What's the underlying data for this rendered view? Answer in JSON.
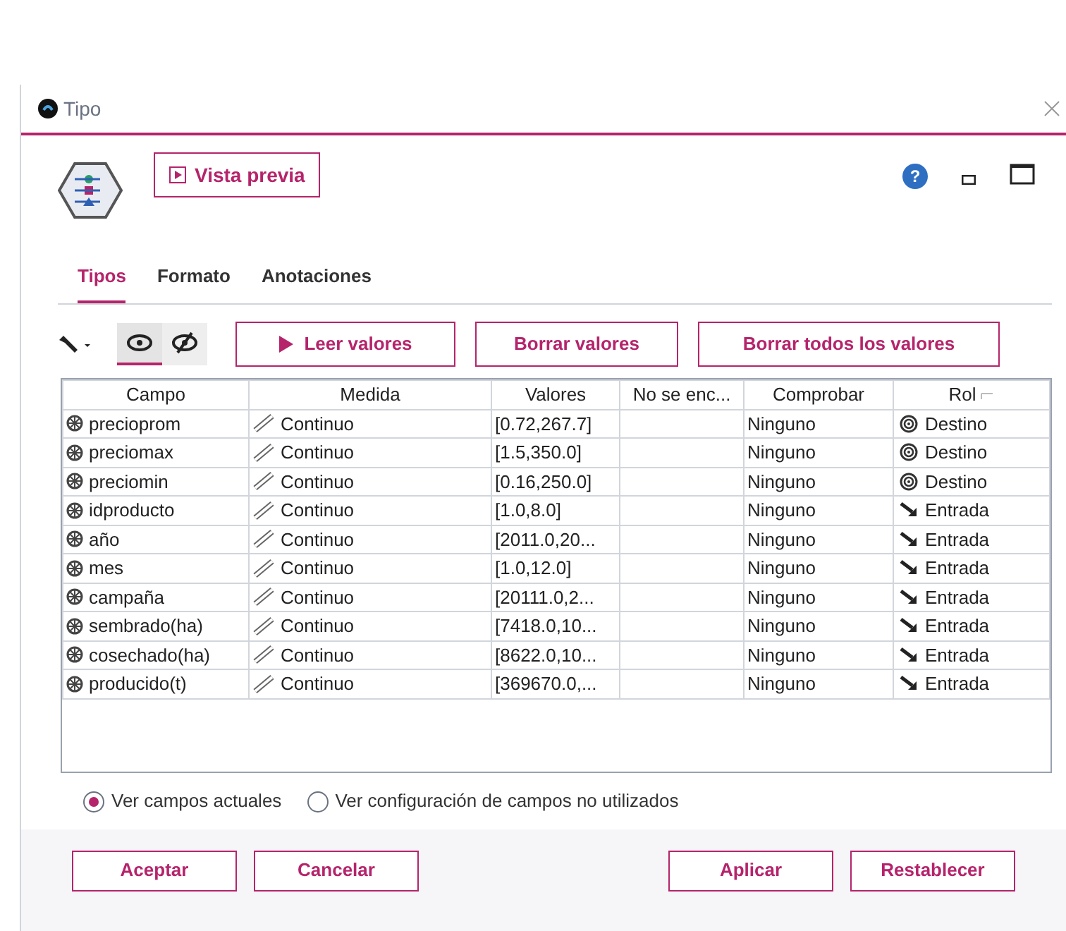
{
  "window": {
    "title": "Tipo"
  },
  "preview_button": "Vista previa",
  "help_button": "?",
  "tabs": [
    {
      "label": "Tipos",
      "selected": true
    },
    {
      "label": "Formato",
      "selected": false
    },
    {
      "label": "Anotaciones",
      "selected": false
    }
  ],
  "view_toggles": [
    {
      "kind": "show",
      "selected": true
    },
    {
      "kind": "hide",
      "selected": false
    }
  ],
  "action_buttons": [
    {
      "label": "Leer valores",
      "kind": "play"
    },
    {
      "label": "Borrar valores",
      "kind": "plain"
    },
    {
      "label": "Borrar todos los valores",
      "kind": "plain"
    }
  ],
  "table": {
    "columns": [
      "Campo",
      "Medida",
      "Valores",
      "No se enc...",
      "Comprobar",
      "Rol"
    ],
    "rows": [
      {
        "campo": "precioprom",
        "medida": "Continuo",
        "valores": "[0.72,267.7]",
        "comprobar": "Ninguno",
        "rol": "Destino",
        "kind": "target"
      },
      {
        "campo": "preciomax",
        "medida": "Continuo",
        "valores": "[1.5,350.0]",
        "comprobar": "Ninguno",
        "rol": "Destino",
        "kind": "target"
      },
      {
        "campo": "preciomin",
        "medida": "Continuo",
        "valores": "[0.16,250.0]",
        "comprobar": "Ninguno",
        "rol": "Destino",
        "kind": "target"
      },
      {
        "campo": "idproducto",
        "medida": "Continuo",
        "valores": "[1.0,8.0]",
        "comprobar": "Ninguno",
        "rol": "Entrada",
        "kind": "input"
      },
      {
        "campo": "año",
        "medida": "Continuo",
        "valores": "[2011.0,20...",
        "comprobar": "Ninguno",
        "rol": "Entrada",
        "kind": "input"
      },
      {
        "campo": "mes",
        "medida": "Continuo",
        "valores": "[1.0,12.0]",
        "comprobar": "Ninguno",
        "rol": "Entrada",
        "kind": "input"
      },
      {
        "campo": "campaña",
        "medida": "Continuo",
        "valores": "[20111.0,2...",
        "comprobar": "Ninguno",
        "rol": "Entrada",
        "kind": "input"
      },
      {
        "campo": "sembrado(ha)",
        "medida": "Continuo",
        "valores": "[7418.0,10...",
        "comprobar": "Ninguno",
        "rol": "Entrada",
        "kind": "input"
      },
      {
        "campo": "cosechado(ha)",
        "medida": "Continuo",
        "valores": "[8622.0,10...",
        "comprobar": "Ninguno",
        "rol": "Entrada",
        "kind": "input"
      },
      {
        "campo": "producido(t)",
        "medida": "Continuo",
        "valores": "[369670.0,...",
        "comprobar": "Ninguno",
        "rol": "Entrada",
        "kind": "input"
      }
    ]
  },
  "view_options": [
    {
      "label": "Ver campos actuales",
      "selected": true
    },
    {
      "label": "Ver configuración de campos no utilizados",
      "selected": false
    }
  ],
  "footer_buttons": [
    "Aceptar",
    "Cancelar",
    "Aplicar",
    "Restablecer"
  ]
}
